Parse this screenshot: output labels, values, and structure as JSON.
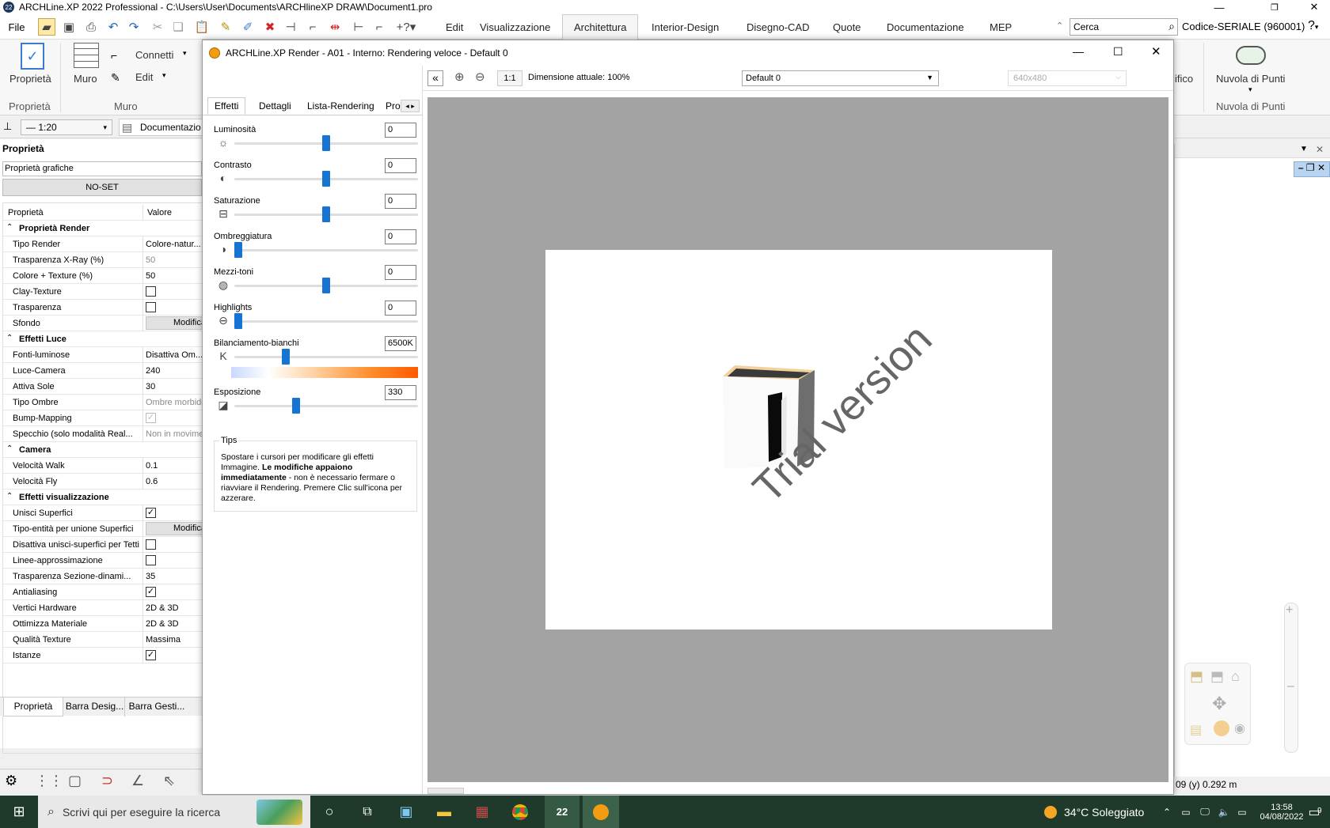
{
  "window": {
    "title": "ARCHLine.XP 2022 Professional - C:\\Users\\User\\Documents\\ARCHlineXP DRAW\\Document1.pro",
    "app_icon": "22"
  },
  "menubar": {
    "file_label": "File",
    "tabs": [
      "Edit",
      "Visualizzazione",
      "Architettura",
      "Interior-Design",
      "Disegno-CAD",
      "Quote",
      "Documentazione",
      "MEP"
    ],
    "active_tab": "Architettura",
    "search_value": "Cerca",
    "serial": "Codice-SERIALE (960001)",
    "help": "?"
  },
  "ribbon": {
    "proprieta_label": "Proprietà",
    "proprieta_group": "Proprietà",
    "muro_label": "Muro",
    "connetti_label": "Connetti",
    "edit_label": "Edit",
    "muro_group": "Muro",
    "nuvola_label": "Nuvola di Punti",
    "nuvola_group": "Nuvola di Punti",
    "partial_label": "ifico"
  },
  "subbar": {
    "scale": "1:20",
    "doc_tab": "Documentazio"
  },
  "left_panel": {
    "title": "Proprietà",
    "dropdown": "Proprietà grafiche",
    "noset_button": "NO-SET",
    "col_name": "Proprietà",
    "col_value": "Valore",
    "rows": [
      {
        "name": "Proprietà Render",
        "section": true
      },
      {
        "name": "Tipo Render",
        "value": "Colore-natur..."
      },
      {
        "name": "Trasparenza X-Ray (%)",
        "value": "50",
        "dim": true
      },
      {
        "name": "Colore + Texture (%)",
        "value": "50"
      },
      {
        "name": "Clay-Texture",
        "check": false
      },
      {
        "name": "Trasparenza",
        "check": false
      },
      {
        "name": "Sfondo",
        "button": "Modifica"
      },
      {
        "name": "Effetti Luce",
        "section": true
      },
      {
        "name": "Fonti-luminose",
        "value": "Disattiva Om..."
      },
      {
        "name": "Luce-Camera",
        "value": "240"
      },
      {
        "name": "Attiva Sole",
        "value": "30"
      },
      {
        "name": "Tipo Ombre",
        "value": "Ombre morbide",
        "dim": true
      },
      {
        "name": "Bump-Mapping",
        "check": true,
        "disabled": true
      },
      {
        "name": "Specchio (solo modalità Real...",
        "value": "Non in movimento",
        "dim": true
      },
      {
        "name": "Camera",
        "section": true
      },
      {
        "name": "Velocità Walk",
        "value": "0.1"
      },
      {
        "name": "Velocità Fly",
        "value": "0.6"
      },
      {
        "name": "Effetti visualizzazione",
        "section": true
      },
      {
        "name": "Unisci Superfici",
        "check": true
      },
      {
        "name": "Tipo-entità per unione Superfici",
        "button": "Modifica"
      },
      {
        "name": "Disattiva unisci-superfici per Tetti",
        "check": false
      },
      {
        "name": "Linee-approssimazione",
        "check": false
      },
      {
        "name": "Trasparenza Sezione-dinami...",
        "value": "35"
      },
      {
        "name": "Antialiasing",
        "check": true
      },
      {
        "name": "Vertici Hardware",
        "value": "2D & 3D"
      },
      {
        "name": "Ottimizza Materiale",
        "value": "2D & 3D"
      },
      {
        "name": "Qualità Texture",
        "value": "Massima"
      },
      {
        "name": "Istanze",
        "check": true
      }
    ],
    "bottom_tabs": [
      "Proprietà",
      "Barra Desig...",
      "Barra Gesti..."
    ]
  },
  "dialog": {
    "title": "ARCHLine.XP Render - A01 - Interno: Rendering veloce - Default 0",
    "tabs": [
      "Effetti",
      "Dettagli",
      "Lista-Rendering",
      "Pro"
    ],
    "zoom_label": "1:1",
    "dimension_text": "Dimensione attuale: 100%",
    "preset": "Default 0",
    "resolution": "640x480",
    "sliders": [
      {
        "label": "Luminosità",
        "value": "0",
        "position": 0.5,
        "icon": "sun-icon"
      },
      {
        "label": "Contrasto",
        "value": "0",
        "position": 0.5,
        "icon": "contrast-icon"
      },
      {
        "label": "Saturazione",
        "value": "0",
        "position": 0.5,
        "icon": "saturation-icon"
      },
      {
        "label": "Ombreggiatura",
        "value": "0",
        "position": 0.0,
        "icon": "shadow-icon"
      },
      {
        "label": "Mezzi-toni",
        "value": "0",
        "position": 0.5,
        "icon": "midtone-icon"
      },
      {
        "label": "Highlights",
        "value": "0",
        "position": 0.0,
        "icon": "highlight-icon"
      },
      {
        "label": "Bilanciamento-bianchi",
        "value": "6500K",
        "position": 0.27,
        "icon": "kelvin-icon"
      },
      {
        "label": "Esposizione",
        "value": "330",
        "position": 0.33,
        "icon": "exposure-icon"
      }
    ],
    "tips_title": "Tips",
    "tips_text_1": "Spostare i cursori per modificare gli effetti Immagine. ",
    "tips_bold": "Le modifiche appaiono immediatamente",
    "tips_text_2": " - non è necessario fermare o riavviare il Rendering. Premere Clic sull'icona per azzerare.",
    "watermark": "Trial version"
  },
  "right_area": {
    "coord": "09  (y) 0.292 m"
  },
  "taskbar": {
    "search_placeholder": "Scrivi qui per eseguire la ricerca",
    "weather": "34°C  Soleggiato",
    "time": "13:58",
    "date": "04/08/2022",
    "notification_count": "9"
  },
  "colors": {
    "accent": "#1874d2",
    "taskbar": "#1f3a2a",
    "render_bg": "#a3a3a3"
  }
}
